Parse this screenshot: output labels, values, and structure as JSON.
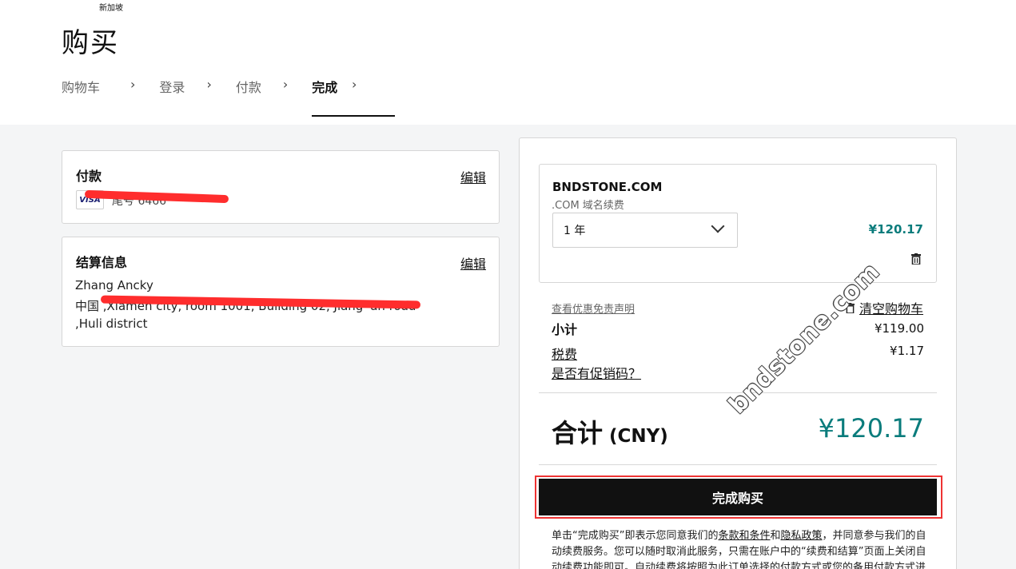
{
  "header": {
    "region": "新加坡",
    "title": "购买",
    "steps": [
      "购物车",
      "登录",
      "付款",
      "完成"
    ],
    "active_step": 3
  },
  "payment_card": {
    "title": "付款",
    "edit_label": "编辑",
    "card_brand": "VISA",
    "card_text": "尾号 6466"
  },
  "billing_card": {
    "title": "结算信息",
    "edit_label": "编辑",
    "name": "Zhang Ancky",
    "address_line1": "中国 ,Xiamen city, room 1001, Building 02, Jiang' an road",
    "address_line2": ",Huli district"
  },
  "order": {
    "item_name": "BNDSTONE.COM",
    "item_desc": ".COM 域名续费",
    "term": "1 年",
    "item_price": "¥120.17",
    "disclaimer_link": "查看优惠免责声明",
    "clear_cart": "清空购物车",
    "subtotal_label": "小计",
    "subtotal_value": "¥119.00",
    "tax_label": "税费",
    "tax_value": "¥1.17",
    "promo_link": "是否有促销码？",
    "total_label": "合计",
    "total_currency": "(CNY)",
    "total_value": "¥120.17",
    "buy_button": "完成购买",
    "terms_pre": "单击“完成购买”即表示您同意我们的",
    "terms_link1": "条款和条件",
    "terms_and": "和",
    "terms_link2": "隐私政策",
    "terms_post": "，并同意参与我们的自动续费服务。您可以随时取消此服务，只需在账户中的“续费和结算”页面上关闭自动续费功能即可。自动续费将按照为此订单选择的付款方式或您的备用付款方式进行结"
  },
  "watermark": "bndstone.com",
  "colors": {
    "accent": "#0a7c7c",
    "highlight": "#ee3333",
    "button": "#111111"
  }
}
